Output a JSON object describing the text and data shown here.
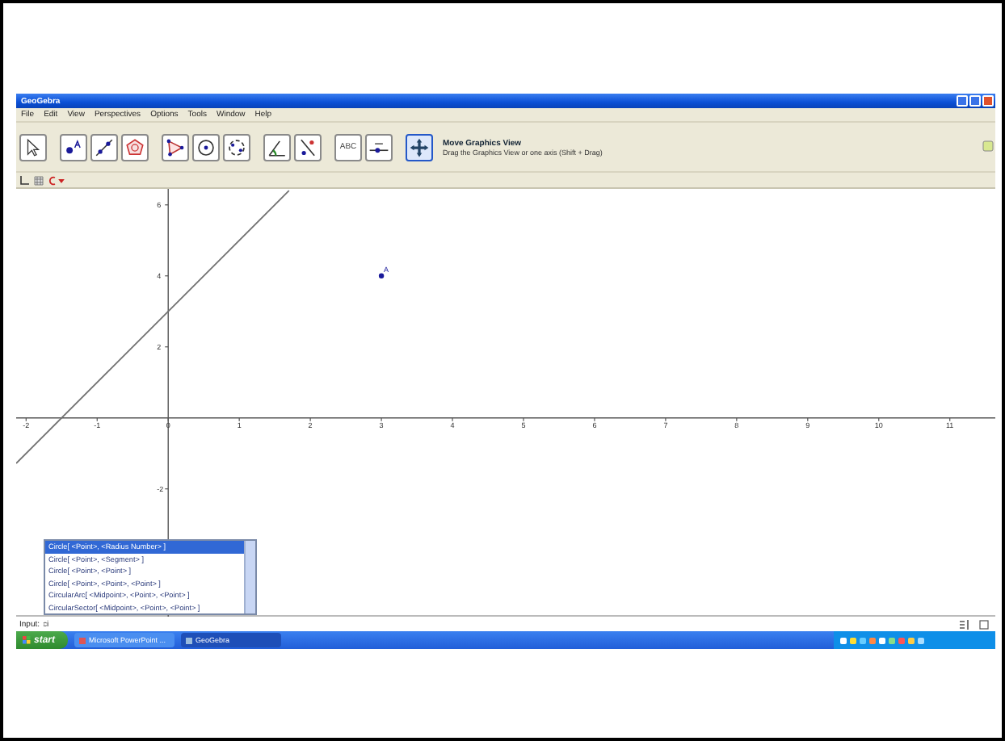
{
  "window": {
    "title": "GeoGebra"
  },
  "menu": [
    "File",
    "Edit",
    "View",
    "Perspectives",
    "Options",
    "Tools",
    "Window",
    "Help"
  ],
  "toolbar": {
    "tools": [
      {
        "kind": "move",
        "selected": false
      },
      {
        "kind": "point",
        "selected": false
      },
      {
        "kind": "line",
        "selected": false
      },
      {
        "kind": "pentagon",
        "selected": false
      },
      {
        "kind": "polygon",
        "selected": false
      },
      {
        "kind": "circle",
        "selected": false
      },
      {
        "kind": "conic",
        "selected": false
      },
      {
        "kind": "angle",
        "selected": false
      },
      {
        "kind": "reflect",
        "selected": false
      },
      {
        "kind": "text",
        "label": "ABC",
        "selected": false
      },
      {
        "kind": "slider",
        "selected": false
      },
      {
        "kind": "pan",
        "selected": true
      }
    ],
    "tool_name": "Move Graphics View",
    "tool_help": "Drag the Graphics View or one axis (Shift + Drag)"
  },
  "graphics": {
    "chart_data": {
      "type": "line",
      "x": [
        -2.14,
        1.7
      ],
      "series": [
        {
          "color": "#707070",
          "values": [
            -1.28,
            6.4
          ]
        }
      ],
      "xlim": [
        -2.14,
        11.64
      ],
      "ylim": [
        -5.6,
        6.45
      ],
      "xticks": [
        -2,
        -1,
        0,
        1,
        2,
        3,
        4,
        5,
        6,
        7,
        8,
        9,
        10,
        11
      ],
      "yticks": [
        -2,
        2,
        4,
        6
      ],
      "annotations": [
        {
          "x": 3,
          "y": 4,
          "text": "A"
        }
      ]
    }
  },
  "autocomplete": [
    {
      "text": "Circle[ <Point>, <Radius Number> ]",
      "selected": true
    },
    {
      "text": "Circle[ <Point>, <Segment> ]",
      "selected": false
    },
    {
      "text": "Circle[ <Point>, <Point> ]",
      "selected": false
    },
    {
      "text": "Circle[ <Point>, <Point>, <Point> ]",
      "selected": false
    },
    {
      "text": "CircularArc[ <Midpoint>, <Point>, <Point> ]",
      "selected": false
    },
    {
      "text": "CircularSector[ <Midpoint>, <Point>, <Point> ]",
      "selected": false
    }
  ],
  "input": {
    "label": "Input:",
    "value": "ci"
  },
  "taskbar": {
    "start": "start",
    "tasks": [
      {
        "label": "Microsoft PowerPoint ...",
        "selected": false
      },
      {
        "label": "GeoGebra",
        "selected": true
      }
    ]
  }
}
